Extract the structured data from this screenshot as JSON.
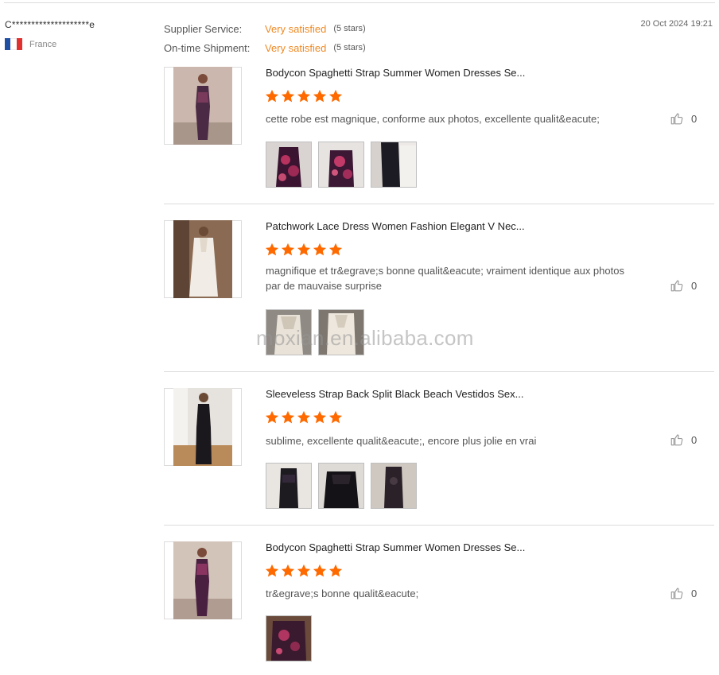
{
  "reviewer": {
    "name": "C********************e",
    "country": "France",
    "flag_colors": [
      "#1f4fa3",
      "#ffffff",
      "#e0302f"
    ]
  },
  "ratings": {
    "supplier_service_label": "Supplier Service:",
    "supplier_service_value": "Very satisfied",
    "supplier_service_stars": "(5 stars)",
    "shipment_label": "On-time Shipment:",
    "shipment_value": "Very satisfied",
    "shipment_stars": "(5 stars)"
  },
  "date": "20 Oct 2024 19:21",
  "accent_color": "#f08a24",
  "star_color": "#ff6a00",
  "items": [
    {
      "product_name": "Bodycon Spaghetti Strap Summer Women Dresses Se...",
      "stars": 5,
      "comment": "cette robe est magnique, conforme aux photos, excellente qualit&eacute;",
      "likes": "0",
      "photo_count": 3
    },
    {
      "product_name": "Patchwork Lace Dress Women Fashion Elegant V Nec...",
      "stars": 5,
      "comment": "magnifique et tr&egrave;s bonne qualit&eacute; vraiment identique aux photos par de mauvaise surprise",
      "likes": "0",
      "photo_count": 2
    },
    {
      "product_name": "Sleeveless Strap Back Split Black Beach Vestidos Sex...",
      "stars": 5,
      "comment": "sublime, excellente qualit&eacute;, encore plus jolie en vrai",
      "likes": "0",
      "photo_count": 3
    },
    {
      "product_name": "Bodycon Spaghetti Strap Summer Women Dresses Se...",
      "stars": 5,
      "comment": "tr&egrave;s bonne qualit&eacute;",
      "likes": "0",
      "photo_count": 1
    }
  ],
  "watermark": "moxian.en.alibaba.com"
}
